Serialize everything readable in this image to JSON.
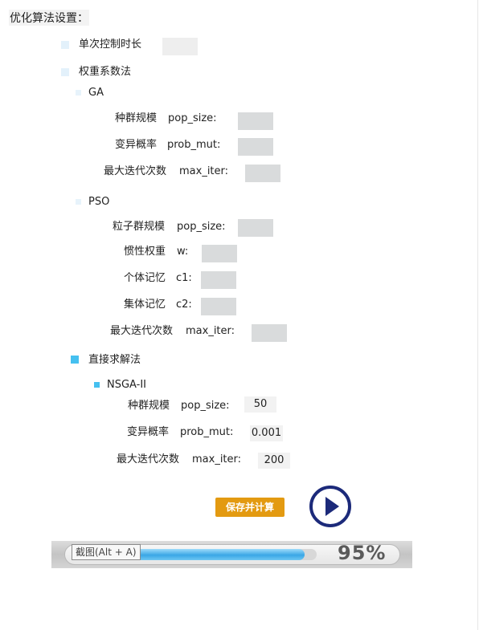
{
  "title": "优化算法设置：",
  "single_control": {
    "label": "单次控制时长",
    "value": ""
  },
  "weight_method": {
    "label": "权重系数法",
    "ga": {
      "label": "GA",
      "pop_size": {
        "cn": "种群规模",
        "key": "pop_size:",
        "value": ""
      },
      "prob_mut": {
        "cn": "变异概率",
        "key": "prob_mut:",
        "value": ""
      },
      "max_iter": {
        "cn": "最大迭代次数",
        "key": "max_iter:",
        "value": ""
      }
    },
    "pso": {
      "label": "PSO",
      "pop_size": {
        "cn": "粒子群规模",
        "key": "pop_size:",
        "value": ""
      },
      "w": {
        "cn": "惯性权重",
        "key": "w:",
        "value": ""
      },
      "c1": {
        "cn": "个体记忆",
        "key": "c1:",
        "value": ""
      },
      "c2": {
        "cn": "集体记忆",
        "key": "c2:",
        "value": ""
      },
      "max_iter": {
        "cn": "最大迭代次数",
        "key": "max_iter:",
        "value": ""
      }
    }
  },
  "direct_method": {
    "label": "直接求解法",
    "nsga": {
      "label": "NSGA-II",
      "pop_size": {
        "cn": "种群规模",
        "key": "pop_size:",
        "value": "50"
      },
      "prob_mut": {
        "cn": "变异概率",
        "key": "prob_mut:",
        "value": "0.001"
      },
      "max_iter": {
        "cn": "最大迭代次数",
        "key": "max_iter:",
        "value": "200"
      }
    }
  },
  "actions": {
    "save_label": "保存并计算",
    "play_icon": "play-circle-icon"
  },
  "progress": {
    "percent": 95,
    "percent_text": "95%",
    "tooltip": "截图(Alt + A)"
  },
  "colors": {
    "accent_blue": "#45c0f0",
    "save_orange": "#e39a11",
    "play_navy": "#1c2a7a"
  }
}
